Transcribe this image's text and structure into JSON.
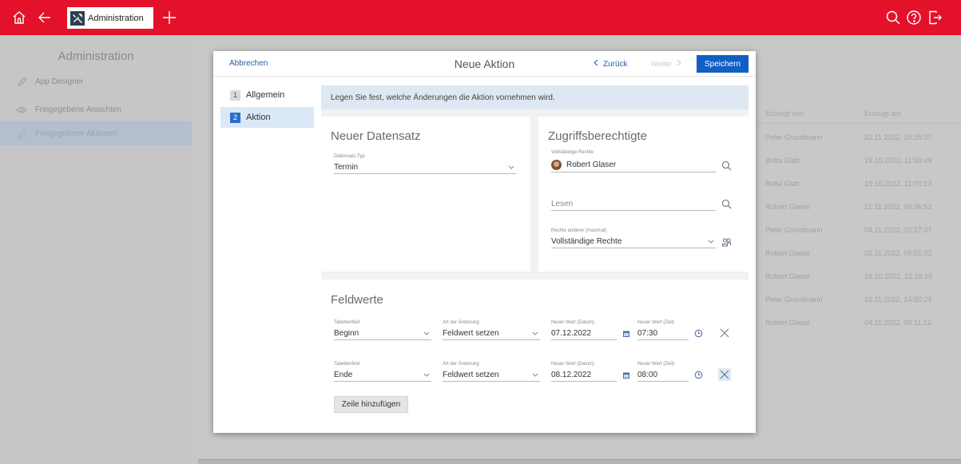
{
  "topbar": {
    "home_icon": "home-icon",
    "back_icon": "arrow-left-icon",
    "tab_label": "Administration",
    "tab_icon": "tools-icon",
    "add_icon": "plus-icon",
    "search_icon": "search-icon",
    "help_icon": "help-icon",
    "logout_icon": "logout-icon",
    "accent": "#e3112a"
  },
  "sidebar": {
    "title": "Administration",
    "items": [
      {
        "label": "App Designer",
        "icon": "pencil-icon"
      },
      {
        "label": "Freigegebene Ansichten",
        "icon": "eye-icon"
      },
      {
        "label": "Freigegebene Aktionen",
        "icon": "action-icon"
      }
    ]
  },
  "background_list": {
    "header_created_by": "Erzeugt von",
    "header_created_at": "Erzeugt am",
    "rows": [
      {
        "by": "Peter Grundmann",
        "at": "22.11.2022, 10:25:37"
      },
      {
        "by": "Britta Glatt",
        "at": "19.10.2022, 11:00:49"
      },
      {
        "by": "Britta Glatt",
        "at": "19.10.2022, 11:00:13"
      },
      {
        "by": "Robert Glaser",
        "at": "21.11.2022, 09:36:53"
      },
      {
        "by": "Peter Grundmann",
        "at": "04.11.2022, 10:27:37"
      },
      {
        "by": "Robert Glaser",
        "at": "02.11.2022, 09:55:32"
      },
      {
        "by": "Robert Glaser",
        "at": "19.10.2022, 12:19:16"
      },
      {
        "by": "Peter Grundmann",
        "at": "10.11.2022, 14:50:24"
      },
      {
        "by": "Robert Glaser",
        "at": "04.11.2022, 09:11:12"
      }
    ]
  },
  "dialog": {
    "abort_label": "Abbrechen",
    "title": "Neue Aktion",
    "back_label": "Zurück",
    "next_label": "Weiter",
    "save_label": "Speichern",
    "save_color": "#0f5fc4",
    "steps": [
      {
        "num": "1",
        "label": "Allgemein",
        "active": false
      },
      {
        "num": "2",
        "label": "Aktion",
        "active": true
      }
    ],
    "info": "Legen Sie fest, welche Änderungen die Aktion vornehmen wird.",
    "new_record": {
      "title": "Neuer Datensatz",
      "type_label": "Datensatz-Typ",
      "type_value": "Termin"
    },
    "access": {
      "title": "Zugriffsberechtigte",
      "full_rights_label": "Vollständige Rechte",
      "full_rights_user": "Robert Glaser",
      "read_placeholder": "Lesen",
      "others_label": "Rechte anderer (maximal)",
      "others_value": "Vollständige Rechte"
    },
    "field_values": {
      "title": "Feldwerte",
      "col_field": "Tabellenfeld",
      "col_change": "Art der Änderung",
      "col_date": "Neuer Wert (Datum)",
      "col_time": "Neuer Wert (Zeit)",
      "rows": [
        {
          "field": "Beginn",
          "change": "Feldwert setzen",
          "date": "07.12.2022",
          "time": "07:30"
        },
        {
          "field": "Ende",
          "change": "Feldwert setzen",
          "date": "08.12.2022",
          "time": "08:00"
        }
      ],
      "add_row_label": "Zeile hinzufügen"
    }
  }
}
